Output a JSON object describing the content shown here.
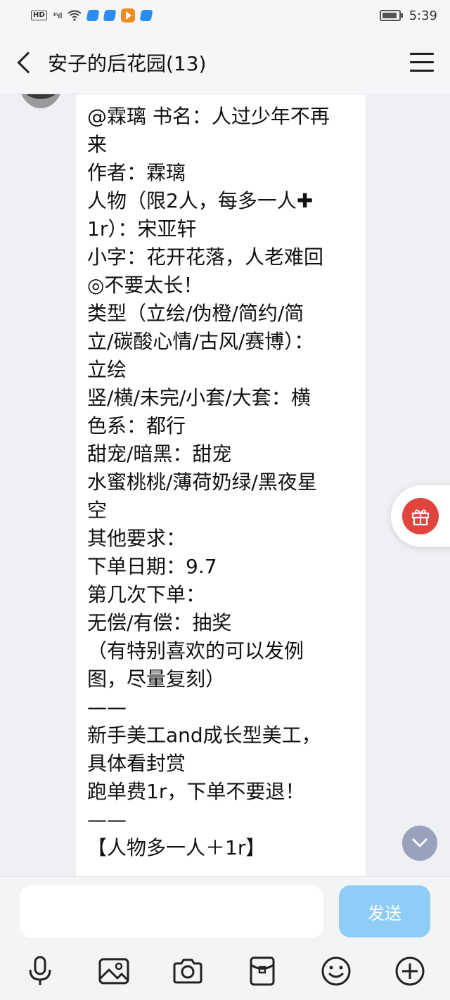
{
  "status_bar": {
    "network": "HD",
    "signal_label": "⁴⁶ıll",
    "time": "5:39"
  },
  "header": {
    "title": "安子的后花园(13)"
  },
  "message": {
    "lines": [
      "@霖璃 书名：人过少年不再",
      "来",
      "作者：霖璃",
      "人物（限2人，每多一人✚",
      "1r）：宋亚轩",
      "小字：花开花落，人老难回",
      "◎不要太长！",
      "类型（立绘/伪橙/简约/简",
      "立/碳酸心情/古风/赛博）：",
      "立绘",
      "竖/横/未完/小套/大套：横",
      "色系：都行",
      "甜宠/暗黑：甜宠",
      "水蜜桃桃/薄荷奶绿/黑夜星",
      "空",
      "其他要求：",
      "下单日期：9.7",
      "第几次下单：",
      "无偿/有偿：抽奖",
      "（有特别喜欢的可以发例",
      "图，尽量复刻）",
      "——",
      "新手美工and成长型美工，",
      "具体看封赏",
      "跑单费1r，下单不要退！",
      "——",
      "【人物多一人＋1r】"
    ]
  },
  "input": {
    "placeholder": "",
    "send_label": "发送"
  },
  "colors": {
    "background": "#eef0f4",
    "send_button": "#8ecdf6",
    "gift_red": "#e0443c",
    "scroll_button": "#9aa1bd"
  },
  "icons": {
    "back": "chevron-left-icon",
    "menu": "hamburger-menu-icon",
    "gift": "gift-icon",
    "scroll": "chevron-down-icon",
    "toolbar": [
      "microphone-icon",
      "image-icon",
      "camera-icon",
      "red-packet-icon",
      "emoji-icon",
      "plus-icon"
    ]
  }
}
